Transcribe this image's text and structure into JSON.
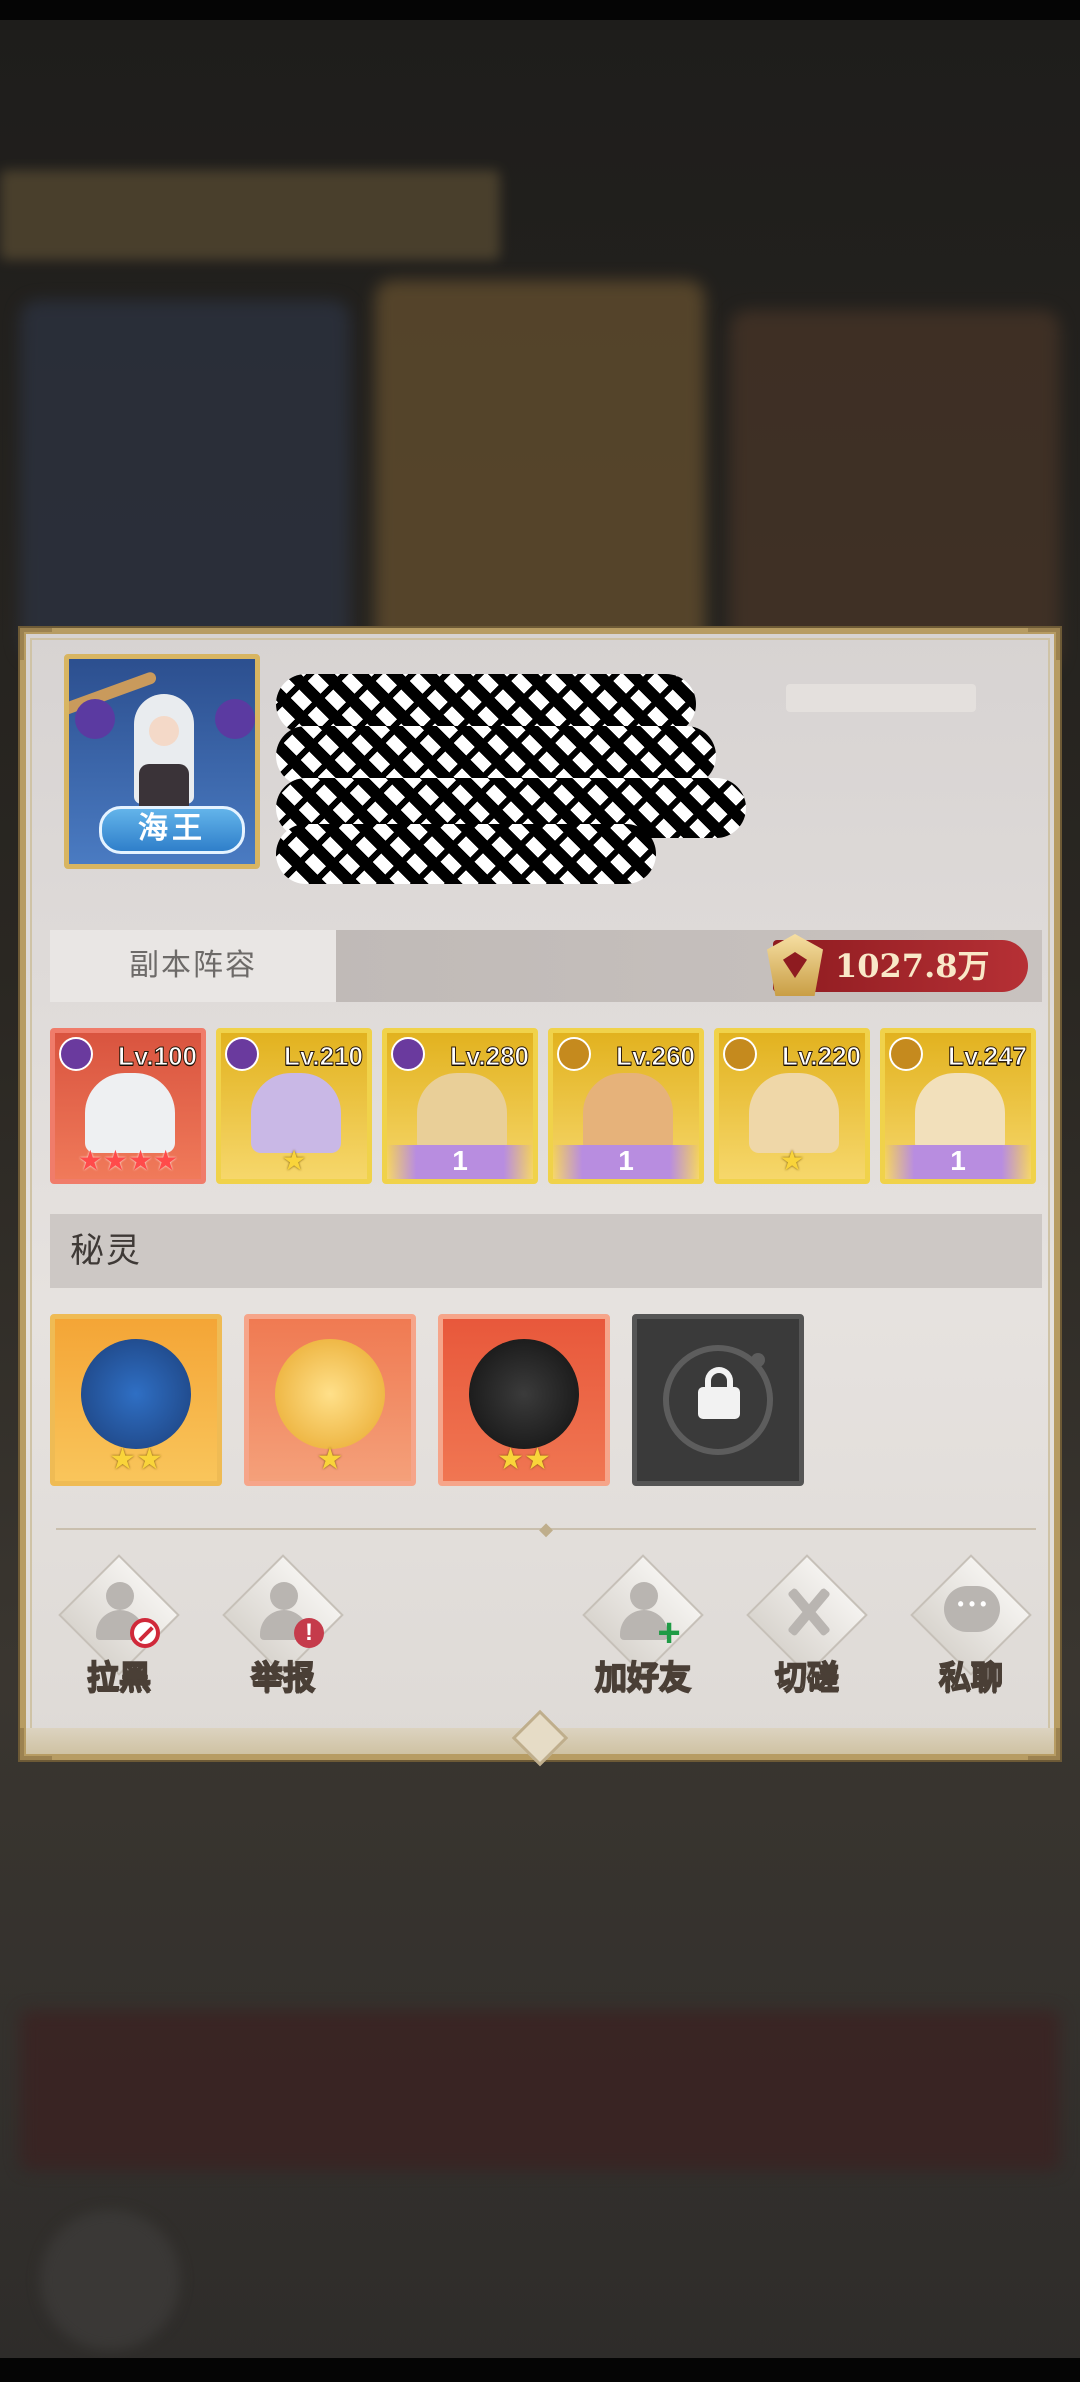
{
  "profile": {
    "title_badge": "海王"
  },
  "lineup": {
    "tab_label": "副本阵容",
    "power_value": "1027.8万",
    "heroes": [
      {
        "level": "Lv.100",
        "faction": "purple",
        "stars": "★★★★",
        "star_style": "red"
      },
      {
        "level": "Lv.210",
        "faction": "purple",
        "stars": "★",
        "star_style": "gold"
      },
      {
        "level": "Lv.280",
        "faction": "purple",
        "stars": "1",
        "star_style": "purple"
      },
      {
        "level": "Lv.260",
        "faction": "gold",
        "stars": "1",
        "star_style": "purple"
      },
      {
        "level": "Lv.220",
        "faction": "gold",
        "stars": "★",
        "star_style": "gold"
      },
      {
        "level": "Lv.247",
        "faction": "gold",
        "stars": "1",
        "star_style": "purple"
      }
    ]
  },
  "spirits": {
    "section_label": "秘灵",
    "items": [
      {
        "name_icon": "blue-dragon-spirit",
        "stars": "★★"
      },
      {
        "name_icon": "golden-fox-spirit",
        "stars": "★"
      },
      {
        "name_icon": "black-rabbit-spirit",
        "stars": "★★"
      },
      {
        "name_icon": "lock-icon",
        "locked": true
      }
    ]
  },
  "actions": {
    "block": "拉黑",
    "report": "举报",
    "add_friend": "加好友",
    "spar": "切磋",
    "private_chat": "私聊"
  },
  "colors": {
    "frame_gold": "#b79c63",
    "power_red": "#b63035",
    "hero_gold": "#f0d24a"
  }
}
